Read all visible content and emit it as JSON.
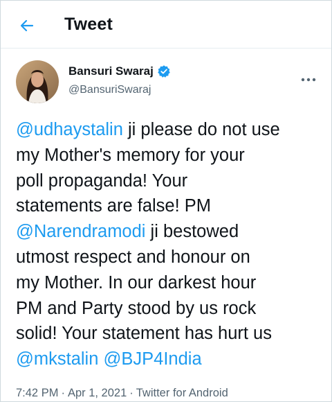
{
  "header": {
    "title": "Tweet",
    "back_icon": "arrow-left-icon"
  },
  "author": {
    "name": "Bansuri Swaraj",
    "handle": "@BansuriSwaraj",
    "verified_icon": "verified-badge-icon",
    "more_icon": "more-horizontal-icon"
  },
  "tweet": {
    "lines": [
      [
        {
          "t": "@udhaystalin",
          "m": true
        },
        {
          "t": " ji please do not use",
          "m": false
        }
      ],
      [
        {
          "t": "my Mother's memory for your",
          "m": false
        }
      ],
      [
        {
          "t": "poll propaganda! Your",
          "m": false
        }
      ],
      [
        {
          "t": "statements are false!  PM",
          "m": false
        }
      ],
      [
        {
          "t": "@Narendramodi",
          "m": true
        },
        {
          "t": " ji bestowed",
          "m": false
        }
      ],
      [
        {
          "t": "utmost respect and honour on",
          "m": false
        }
      ],
      [
        {
          "t": "my Mother. In our darkest hour",
          "m": false
        }
      ],
      [
        {
          "t": "PM and Party stood by us rock",
          "m": false
        }
      ],
      [
        {
          "t": "solid! Your statement has hurt us",
          "m": false
        }
      ],
      [
        {
          "t": "@mkstalin",
          "m": true
        },
        {
          "t": " ",
          "m": false
        },
        {
          "t": "@BJP4India",
          "m": true
        }
      ]
    ]
  },
  "meta": {
    "time": "7:42 PM",
    "separator": "·",
    "date": "Apr 1, 2021",
    "source": "Twitter for Android"
  },
  "colors": {
    "accent": "#1d9bf0",
    "text": "#0f1419",
    "secondary": "#536471"
  }
}
